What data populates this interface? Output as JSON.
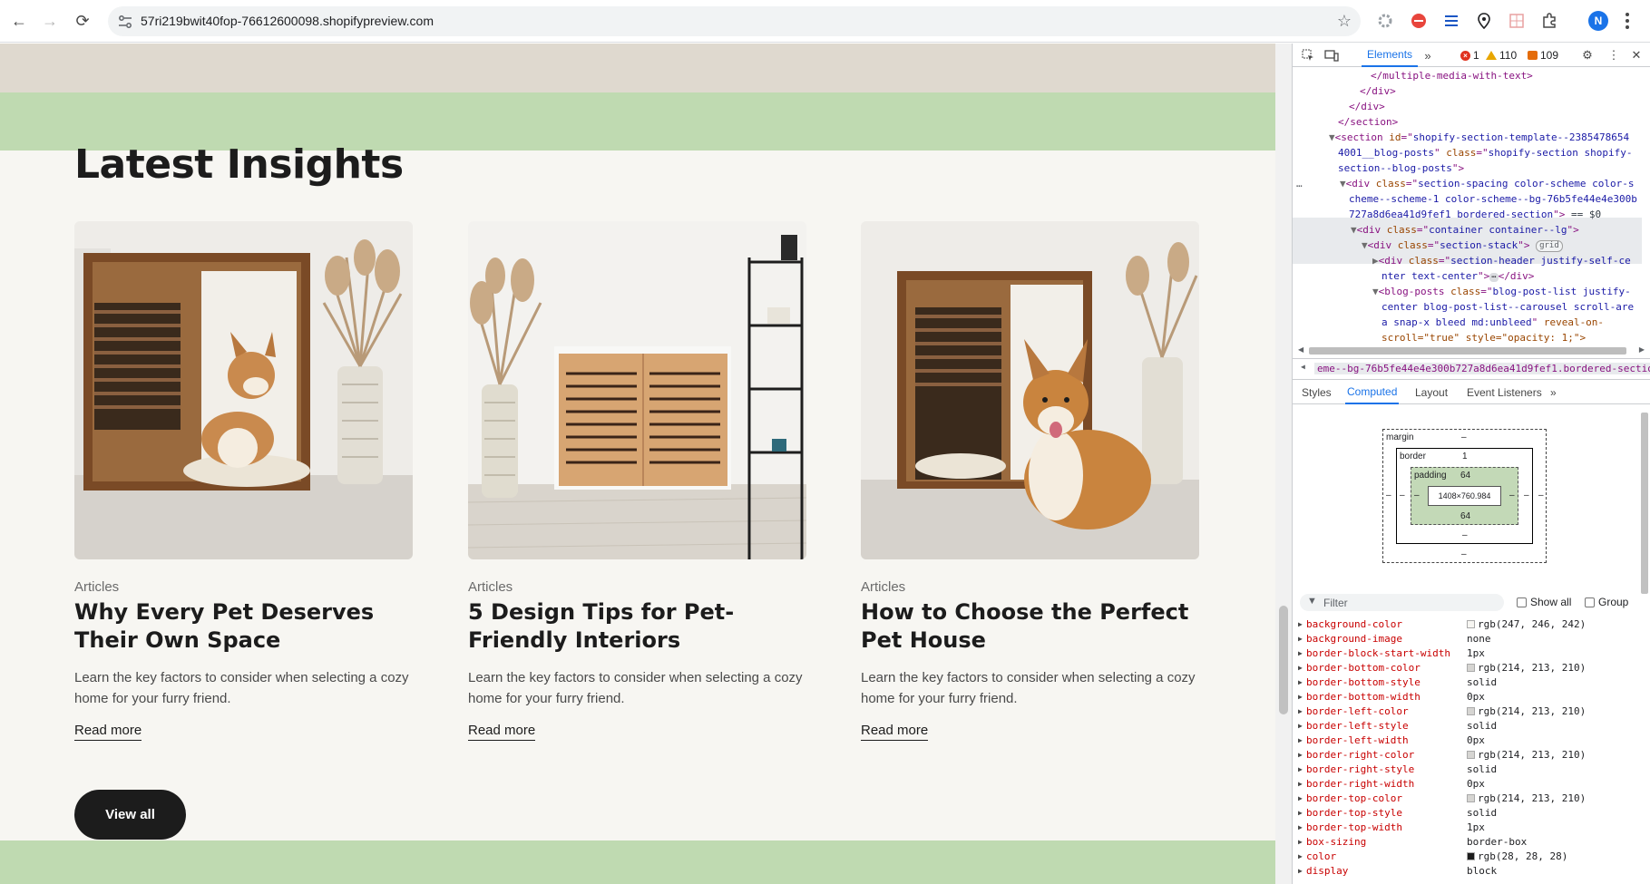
{
  "browser": {
    "url": "57ri219bwit40fop-76612600098.shopifypreview.com",
    "profile_initial": "N",
    "extensions": [
      "ext-gear-icon",
      "ext-ab-icon",
      "ext-list-icon",
      "ext-map-pin-icon",
      "ext-grid-icon",
      "puzzle-icon"
    ]
  },
  "page": {
    "section_title": "Latest Insights",
    "view_all_label": "View all",
    "cards": [
      {
        "category": "Articles",
        "title": "Why Every Pet Deserves Their Own Space",
        "excerpt": "Learn the key factors to consider when selecting a cozy home for your furry friend.",
        "link": "Read more"
      },
      {
        "category": "Articles",
        "title": "5 Design Tips for Pet-Friendly Interiors",
        "excerpt": "Learn the key factors to consider when selecting a cozy home for your furry friend.",
        "link": "Read more"
      },
      {
        "category": "Articles",
        "title": "How to Choose the Perfect Pet House",
        "excerpt": "Learn the key factors to consider when selecting a cozy home for your furry friend.",
        "link": "Read more"
      }
    ],
    "colors": {
      "background": "#f7f6f2",
      "accent_band": "#bfdab1",
      "top_band": "#dfd9cf",
      "button": "#1c1c1c"
    }
  },
  "devtools": {
    "tab_elements": "Elements",
    "errors": "1",
    "warnings": "110",
    "issues": "109",
    "dom_lines": [
      "</multiple-media-with-text>",
      "</div>",
      "</div>",
      "</section>"
    ],
    "section_id_attr": "shopify-section-template--2385478654",
    "section_id_attr2": "4001__blog-posts",
    "section_class": "shopify-section shopify-",
    "section_class2": "section--blog-posts",
    "div_class_1": "section-spacing color-scheme color-s",
    "div_class_2": "cheme--scheme-1 color-scheme--bg-76b5fe44e4e300b",
    "div_class_3": "727a8d6ea41d9fef1 bordered-section",
    "dollar0": "== $0",
    "container_class": "container container--lg",
    "stack_class": "section-stack",
    "grid_badge": "grid",
    "header_class_1": "section-header justify-self-ce",
    "header_class_2": "nter text-center",
    "blog_class_1": "blog-post-list justify-",
    "blog_class_2": "center blog-post-list--carousel scroll-are",
    "blog_class_3": "a snap-x bleed md:unbleed",
    "blog_reveal": "reveal-on-",
    "blog_reveal2": "scroll=\"true\" style=\"opacity: 1;\">",
    "breadcrumb": "eme--bg-76b5fe44e4e300b727a8d6ea41d9fef1.bordered-section",
    "style_tabs": [
      "Styles",
      "Computed",
      "Layout",
      "Event Listeners"
    ],
    "box_model": {
      "margin_label": "margin",
      "margin_top": "–",
      "border_label": "border",
      "border_top": "1",
      "padding_label": "padding",
      "padding_top": "64",
      "content": "1408×760.984",
      "padding_bottom": "64",
      "border_bottom": "–",
      "margin_bottom": "–",
      "side": "–"
    },
    "filter_placeholder": "Filter",
    "show_all_label": "Show all",
    "group_label": "Group",
    "properties": [
      {
        "name": "background-color",
        "value": "rgb(247, 246, 242)",
        "swatch": "#f7f6f2"
      },
      {
        "name": "background-image",
        "value": "none"
      },
      {
        "name": "border-block-start-width",
        "value": "1px"
      },
      {
        "name": "border-bottom-color",
        "value": "rgb(214, 213, 210)",
        "swatch": "#d6d5d2"
      },
      {
        "name": "border-bottom-style",
        "value": "solid"
      },
      {
        "name": "border-bottom-width",
        "value": "0px"
      },
      {
        "name": "border-left-color",
        "value": "rgb(214, 213, 210)",
        "swatch": "#d6d5d2"
      },
      {
        "name": "border-left-style",
        "value": "solid"
      },
      {
        "name": "border-left-width",
        "value": "0px"
      },
      {
        "name": "border-right-color",
        "value": "rgb(214, 213, 210)",
        "swatch": "#d6d5d2"
      },
      {
        "name": "border-right-style",
        "value": "solid"
      },
      {
        "name": "border-right-width",
        "value": "0px"
      },
      {
        "name": "border-top-color",
        "value": "rgb(214, 213, 210)",
        "swatch": "#d6d5d2"
      },
      {
        "name": "border-top-style",
        "value": "solid"
      },
      {
        "name": "border-top-width",
        "value": "1px"
      },
      {
        "name": "box-sizing",
        "value": "border-box"
      },
      {
        "name": "color",
        "value": "rgb(28, 28, 28)",
        "swatch": "#1c1c1c"
      },
      {
        "name": "display",
        "value": "block"
      }
    ]
  }
}
